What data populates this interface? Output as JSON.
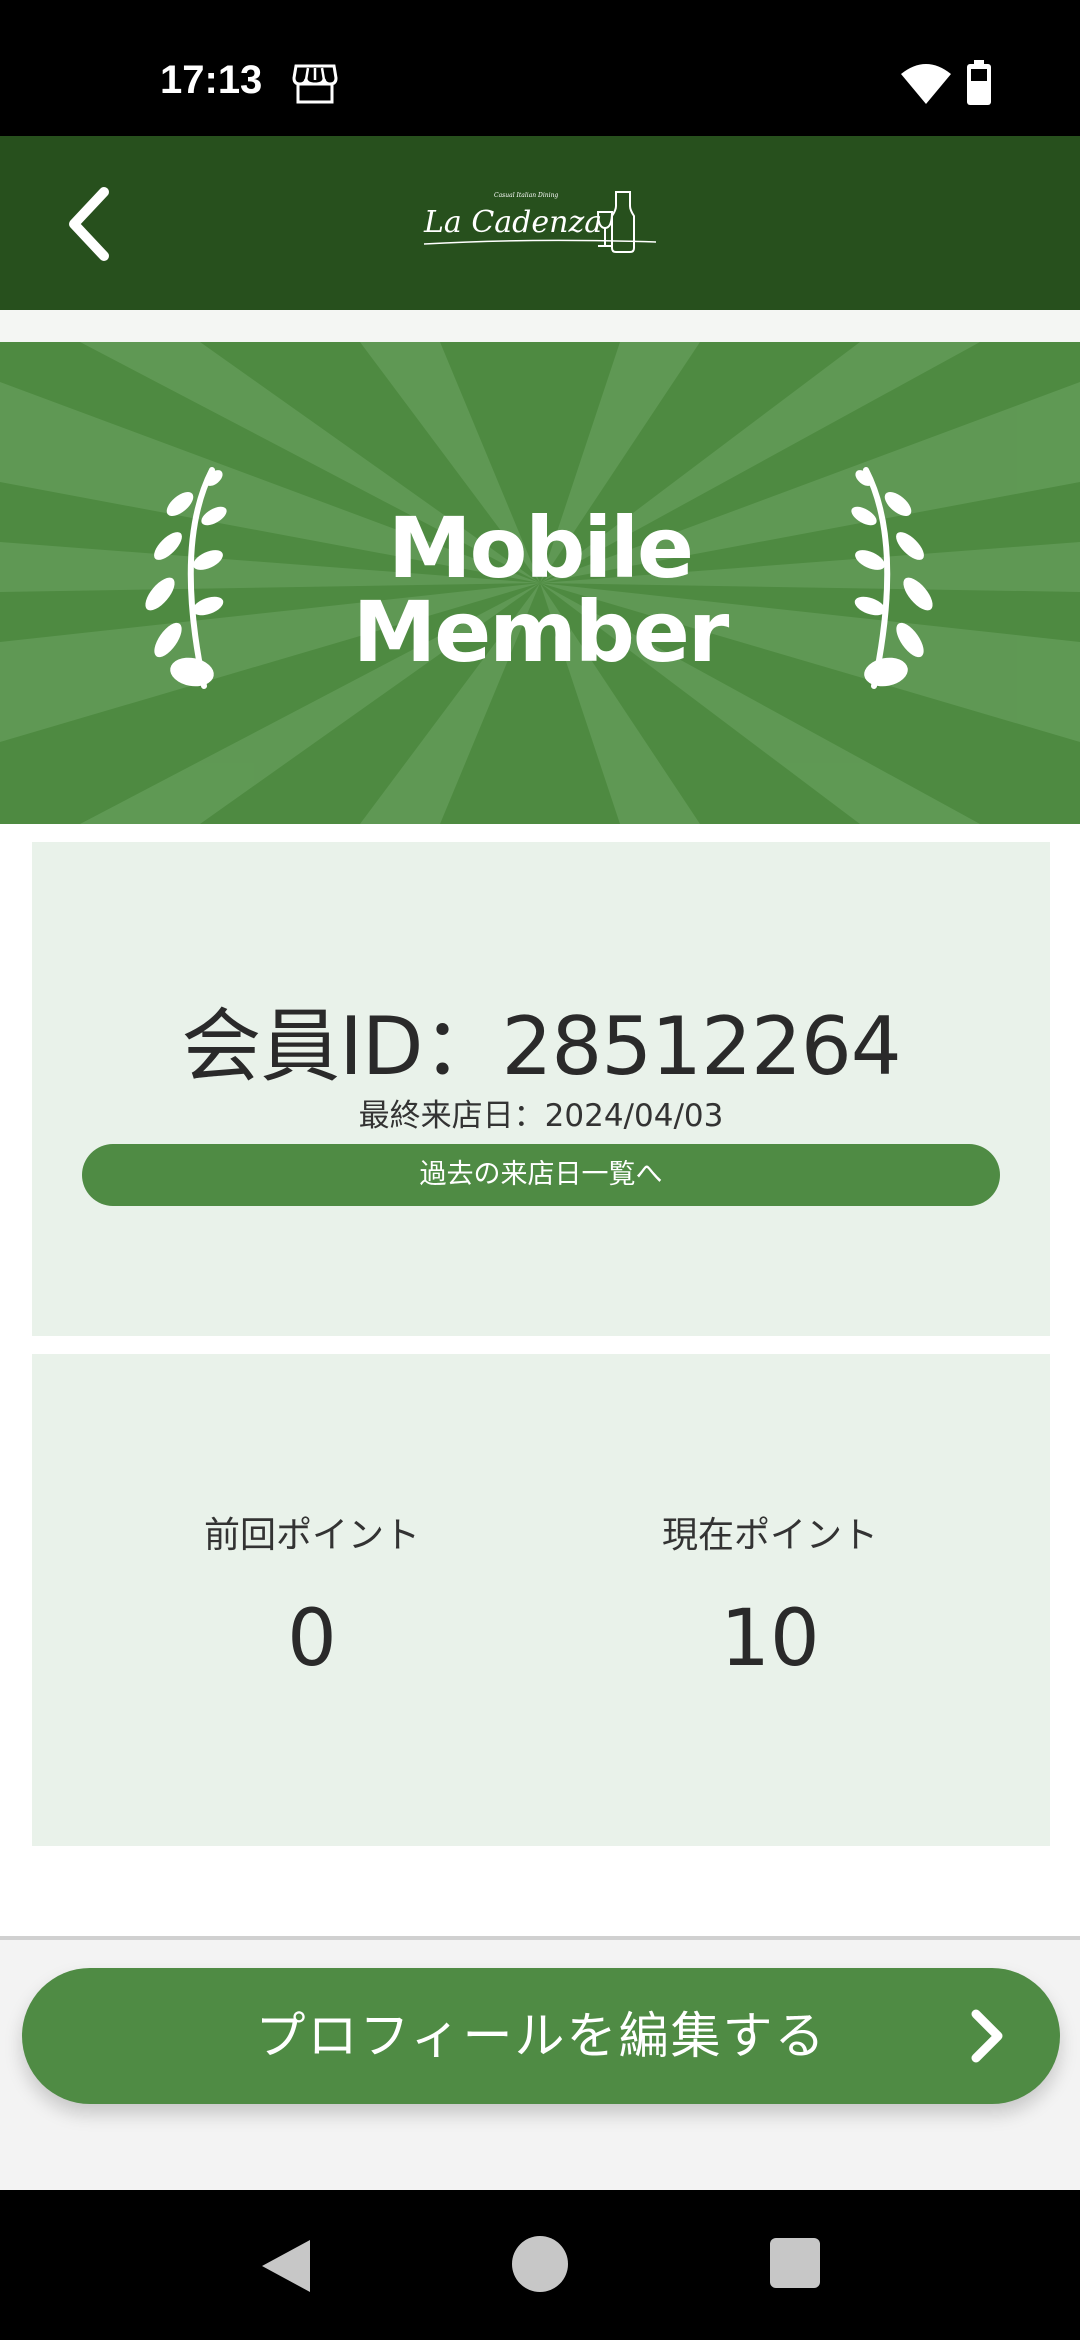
{
  "status_bar": {
    "time": "17:13",
    "icons": [
      "store-icon",
      "wifi-icon",
      "battery-icon"
    ]
  },
  "header": {
    "back_icon": "chevron-left-icon",
    "logo_text": "La Cadenza",
    "logo_subtitle": "Casual Italian Dining"
  },
  "banner": {
    "title_line1": "Mobile",
    "title_line2": "Member"
  },
  "member": {
    "id_text": "会員ID：28512264",
    "last_visit_text": "最終来店日：2024/04/03",
    "history_button_label": "過去の来店日一覧へ"
  },
  "points": {
    "previous_label": "前回ポイント",
    "previous_value": "0",
    "current_label": "現在ポイント",
    "current_value": "10"
  },
  "bottom": {
    "edit_profile_label": "プロフィールを編集する",
    "chevron_icon": "chevron-right-icon"
  },
  "colors": {
    "header_bg": "#27501d",
    "banner_bg": "#4e8a41",
    "card_bg": "#e9f2ea",
    "button_green": "#4f8b44"
  }
}
